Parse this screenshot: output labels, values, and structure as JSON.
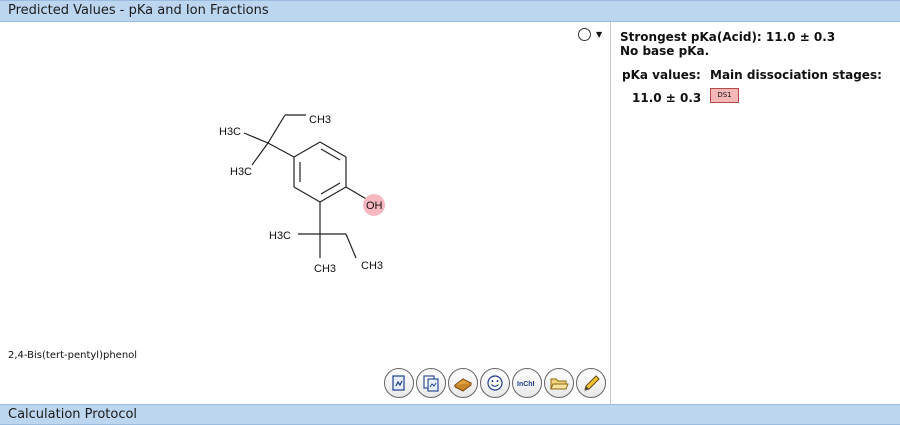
{
  "header": {
    "title": "Predicted Values - pKa and Ion Fractions"
  },
  "footer": {
    "title": "Calculation Protocol"
  },
  "structure": {
    "atoms": {
      "h3c_1": "H3C",
      "h3c_2": "H3C",
      "ch3_1": "CH3",
      "oh": "OH",
      "h3c_3": "H3C",
      "ch3_2": "CH3",
      "ch3_3": "CH3"
    }
  },
  "compound": {
    "name": "2,4-Bis(tert-pentyl)phenol"
  },
  "toolbar": {
    "icons": [
      "export-image-icon",
      "copy-structure-icon",
      "book-icon",
      "smiley-icon",
      "inchi-icon",
      "open-folder-icon",
      "edit-pencil-icon"
    ],
    "inchi_label": "InChI"
  },
  "results": {
    "strongest_acid": "Strongest pKa(Acid): 11.0 ± 0.3",
    "no_base": "No base pKa.",
    "pka_values_header": "pKa values:",
    "stages_header": "Main dissociation stages:",
    "pka_value": "11.0 ± 0.3",
    "stage_badge": "DS1",
    "stage_badge_color": "#f5b8b8"
  }
}
